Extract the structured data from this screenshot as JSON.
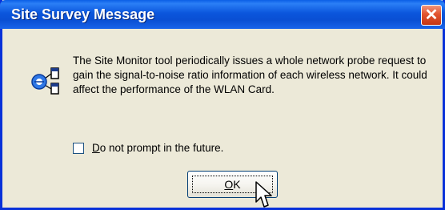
{
  "window": {
    "title": "Site Survey Message",
    "close_glyph": "✕"
  },
  "message": {
    "text": "The Site Monitor tool periodically issues a whole network probe request to gain the signal-to-noise ratio information of each wireless network. It could affect the performance of the WLAN Card.",
    "icon": "network-probe-icon"
  },
  "checkbox": {
    "underlined_char": "D",
    "label_rest": "o not prompt in the future.",
    "checked": false
  },
  "ok_button": {
    "underlined_char": "O",
    "label_rest": "K"
  },
  "colors": {
    "titlebar": "#0a56dd",
    "dialog_bg": "#ece9d8",
    "close_button": "#e2532f"
  }
}
